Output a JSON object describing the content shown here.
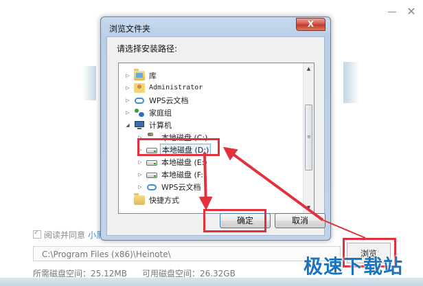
{
  "installer": {
    "close_glyph": "✕",
    "agree_text": "阅读并同意",
    "agree_link": "小黑",
    "install_path": "C:\\Program Files (x86)\\Heinote\\",
    "browse_label": "浏览",
    "required_space": "所需磁盘空间：25.12MB",
    "available_space": "可用磁盘空间：26.32GB"
  },
  "dialog": {
    "title": "浏览文件夹",
    "close_glyph": "X",
    "prompt": "请选择安装路径:",
    "tree": [
      {
        "label": "库",
        "icon": "library-folder-icon",
        "expander": "▷"
      },
      {
        "label": "Administrator",
        "icon": "user-folder-icon",
        "expander": "▷"
      },
      {
        "label": "WPS云文档",
        "icon": "cloud-icon",
        "expander": "▷"
      },
      {
        "label": "家庭组",
        "icon": "homegroup-icon",
        "expander": "▷"
      },
      {
        "label": "计算机",
        "icon": "computer-icon",
        "expander": "◢"
      },
      {
        "label": "本地磁盘 (C:)",
        "icon": "system-drive-icon",
        "expander": "▷"
      },
      {
        "label": "本地磁盘 (D:)",
        "icon": "drive-icon",
        "expander": "▷",
        "selected": true
      },
      {
        "label": "本地磁盘 (E:)",
        "icon": "drive-icon",
        "expander": "▷"
      },
      {
        "label": "本地磁盘 (F:)",
        "icon": "drive-icon",
        "expander": "▷"
      },
      {
        "label": "WPS云文档",
        "icon": "cloud-icon",
        "expander": "▷"
      },
      {
        "label": "快捷方式",
        "icon": "folder-icon",
        "expander": ""
      }
    ],
    "scroll_up": "▲",
    "scroll_down": "▼",
    "scroll_grip": "≡",
    "ok_label": "确定",
    "cancel_label": "取消"
  },
  "watermark": "极速下载站",
  "annotation_color": "#e2313c"
}
